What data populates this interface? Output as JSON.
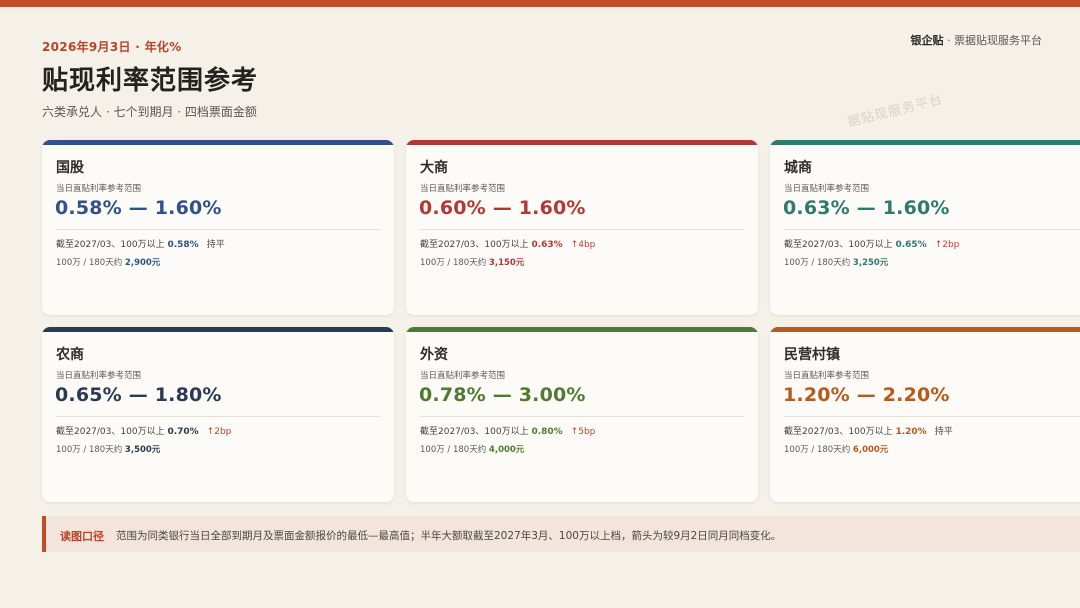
{
  "header": {
    "date": "2026年9月3日 · 年化%",
    "brand_bold": "银企贴",
    "brand_rest": " · 票据贴现服务平台",
    "title": "贴现利率范围参考",
    "subtitle": "六类承兑人 · 七个到期月 · 四档票面金额",
    "watermark": "据贴现服务平台"
  },
  "cards": [
    {
      "name": "国股",
      "label": "当日直贴利率参考范围",
      "range": "0.58% — 1.60%",
      "ref_text": "截至2027/03、100万以上",
      "ref_value": "0.58%",
      "change": "持平",
      "cost_text": "100万 / 180天约",
      "cost_value": "2,900元",
      "color": "#2f5288"
    },
    {
      "name": "大商",
      "label": "当日直贴利率参考范围",
      "range": "0.60% — 1.60%",
      "ref_text": "截至2027/03、100万以上",
      "ref_value": "0.63%",
      "change": "↑4bp",
      "cost_text": "100万 / 180天约",
      "cost_value": "3,150元",
      "color": "#b03a33"
    },
    {
      "name": "城商",
      "label": "当日直贴利率参考范围",
      "range": "0.63% — 1.60%",
      "ref_text": "截至2027/03、100万以上",
      "ref_value": "0.65%",
      "change": "↑2bp",
      "cost_text": "100万 / 180天约",
      "cost_value": "3,250元",
      "color": "#2e7a6c"
    },
    {
      "name": "农商",
      "label": "当日直贴利率参考范围",
      "range": "0.65% — 1.80%",
      "ref_text": "截至2027/03、100万以上",
      "ref_value": "0.70%",
      "change": "↑2bp",
      "cost_text": "100万 / 180天约",
      "cost_value": "3,500元",
      "color": "#2a3a52"
    },
    {
      "name": "外资",
      "label": "当日直贴利率参考范围",
      "range": "0.78% — 3.00%",
      "ref_text": "截至2027/03、100万以上",
      "ref_value": "0.80%",
      "change": "↑5bp",
      "cost_text": "100万 / 180天约",
      "cost_value": "4,000元",
      "color": "#4f7a2f"
    },
    {
      "name": "民营村镇",
      "label": "当日直贴利率参考范围",
      "range": "1.20% — 2.20%",
      "ref_text": "截至2027/03、100万以上",
      "ref_value": "1.20%",
      "change": "持平",
      "cost_text": "100万 / 180天约",
      "cost_value": "6,000元",
      "color": "#b55a1a"
    }
  ],
  "note": {
    "tag": "读图口径",
    "text": "范围为同类银行当日全部到期月及票面金额报价的最低—最高值；半年大额取截至2027年3月、100万以上档，箭头为较9月2日同月同档变化。"
  }
}
